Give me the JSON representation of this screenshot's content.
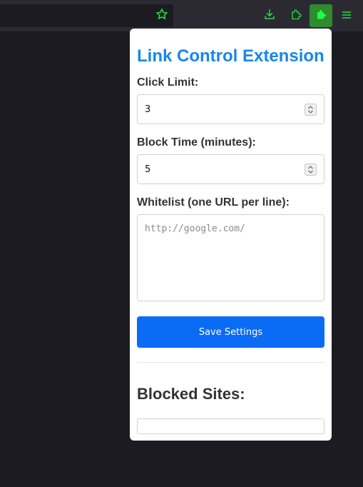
{
  "browser": {
    "toolbar_icons": [
      "star-icon",
      "download-icon",
      "puzzle-icon",
      "extension-active-icon",
      "menu-icon"
    ],
    "accent_color": "#22dd44"
  },
  "popup": {
    "title": "Link Control Extension",
    "click_limit": {
      "label": "Click Limit:",
      "value": "3"
    },
    "block_time": {
      "label": "Block Time (minutes):",
      "value": "5"
    },
    "whitelist": {
      "label": "Whitelist (one URL per line):",
      "placeholder": "http://google.com/"
    },
    "save_label": "Save Settings",
    "blocked_sites_title": "Blocked Sites:",
    "colors": {
      "title": "#1a86e8",
      "button": "#0a6cf5"
    }
  }
}
